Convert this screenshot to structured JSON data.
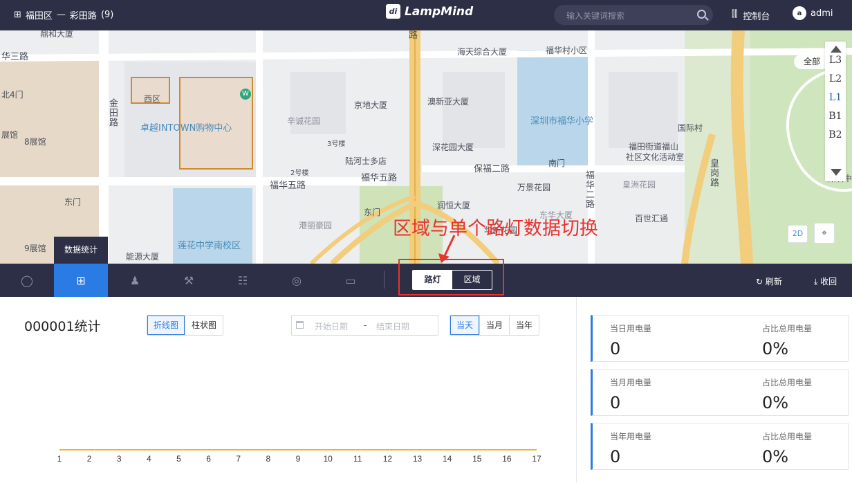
{
  "header": {
    "region": "福田区",
    "separator": "—",
    "road": "彩田路",
    "count": "(9)",
    "logo_mark": "di",
    "logo_text": "LampMind",
    "search_placeholder": "输入关键词搜索",
    "console_label": "控制台",
    "user_name": "admi",
    "user_avatar_text": "a"
  },
  "map": {
    "labels": {
      "l01": "鼎和大厦",
      "l02": "华三路",
      "l03": "北4门",
      "l04": "金田路",
      "l05": "西区",
      "l06": "卓越INTOWN购物中心",
      "l06b": "W",
      "l07": "辛诚花园",
      "l08": "3号楼",
      "l09": "2号楼",
      "l10": "陆河士多店",
      "l11": "福华五路",
      "l12": "福华五路",
      "l13": "东门",
      "l14": "东门",
      "l15": "8展馆",
      "l16": "展馆",
      "l17": "9展馆",
      "l18": "能源大厦",
      "l19": "莲花中学南校区",
      "l20": "港丽豪园",
      "l21": "海天综合大厦",
      "l22": "京地大厦",
      "l23": "澳新亚大厦",
      "l24": "深花园大厦",
      "l25": "保福二路",
      "l26": "润恒大厦",
      "l27": "福华村小区",
      "l28": "深圳市福华小学",
      "l29": "国际村",
      "l30": "福田街道福山",
      "l31": "社区文化活动室",
      "l32": "南门",
      "l33": "万景花园",
      "l34": "福华二路",
      "l35": "皇洲花园",
      "l36": "百世汇通",
      "l37": "东华大厦",
      "l38": "华新花园",
      "l39": "深圳中",
      "l40": "皇岗路",
      "l41": "路"
    },
    "floors": [
      "L3",
      "L2",
      "L1",
      "B1",
      "B2"
    ],
    "floor_active": "L1",
    "floor_all": "全部",
    "btn_2d": "2D",
    "annotation": "区域与单个路灯数据切换"
  },
  "toolbar": {
    "tooltip": "数据统计",
    "toggle_streetlight": "路灯",
    "toggle_area": "区域",
    "refresh": "刷新",
    "collapse": "收回",
    "icons": [
      "lightbulb-icon",
      "sitemap-icon",
      "person-icon",
      "wrench-icon",
      "sliders-icon",
      "globe-icon",
      "video-icon"
    ]
  },
  "stats": {
    "title": "000001统计",
    "chart_types": [
      "折线图",
      "柱状图"
    ],
    "start_placeholder": "开始日期",
    "range_sep": "-",
    "end_placeholder": "结束日期",
    "periods": [
      "当天",
      "当月",
      "当年"
    ],
    "cards": [
      {
        "label_left": "当日用电量",
        "value_left": "0",
        "label_right": "占比总用电量",
        "value_right": "0%"
      },
      {
        "label_left": "当月用电量",
        "value_left": "0",
        "label_right": "占比总用电量",
        "value_right": "0%"
      },
      {
        "label_left": "当年用电量",
        "value_left": "0",
        "label_right": "占比总用电量",
        "value_right": "0%"
      }
    ]
  },
  "chart_data": {
    "type": "line",
    "x": [
      1,
      2,
      3,
      4,
      5,
      6,
      7,
      8,
      9,
      10,
      11,
      12,
      13,
      14,
      15,
      16,
      17
    ],
    "series": [
      {
        "values": [
          0,
          0,
          0,
          0,
          0,
          0,
          0,
          0,
          0,
          0,
          0,
          0,
          0,
          0,
          0,
          0,
          0
        ],
        "color": "#f5b21b"
      }
    ]
  }
}
